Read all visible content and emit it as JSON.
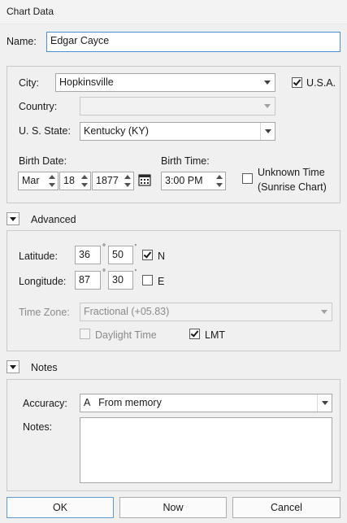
{
  "window": {
    "title": "Chart Data"
  },
  "name": {
    "label": "Name:",
    "value": "Edgar Cayce"
  },
  "location": {
    "city_label": "City:",
    "city_value": "Hopkinsville",
    "usa_label": "U.S.A.",
    "usa_checked": true,
    "country_label": "Country:",
    "country_value": "",
    "state_label": "U. S. State:",
    "state_value": "Kentucky (KY)"
  },
  "birth": {
    "date_label": "Birth Date:",
    "month": "Mar",
    "day": "18",
    "year": "1877",
    "time_label": "Birth Time:",
    "time": "3:00 PM",
    "unknown_time_line1": "Unknown Time",
    "unknown_time_line2": "(Sunrise Chart)",
    "unknown_time_checked": false
  },
  "advanced": {
    "header": "Advanced",
    "latitude_label": "Latitude:",
    "lat_deg": "36",
    "lat_min": "50",
    "lat_dir": "N",
    "lat_dir_checked": true,
    "longitude_label": "Longitude:",
    "lon_deg": "87",
    "lon_min": "30",
    "lon_dir": "E",
    "lon_dir_checked": false,
    "timezone_label": "Time Zone:",
    "timezone_value": "Fractional (+05.83)",
    "daylight_label": "Daylight Time",
    "daylight_checked": false,
    "lmt_label": "LMT",
    "lmt_checked": true,
    "degree_symbol": "°",
    "minute_symbol": "'"
  },
  "notes": {
    "header": "Notes",
    "accuracy_label": "Accuracy:",
    "accuracy_value": "A   From memory",
    "notes_label": "Notes:",
    "notes_value": ""
  },
  "buttons": {
    "ok": "OK",
    "now": "Now",
    "cancel": "Cancel"
  }
}
